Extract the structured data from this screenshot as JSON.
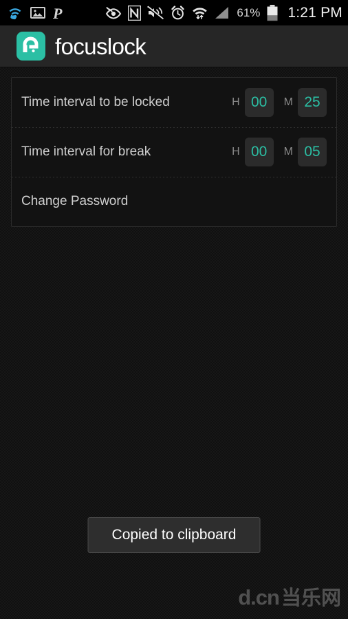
{
  "status_bar": {
    "left_icons": [
      {
        "name": "wifi-calling-icon",
        "glyph": "wifi-call"
      },
      {
        "name": "gallery-image-icon",
        "glyph": "image"
      },
      {
        "name": "paypal-icon",
        "glyph": "P"
      }
    ],
    "right_icons": [
      {
        "name": "smart-stay-eye-icon",
        "glyph": "eye"
      },
      {
        "name": "nfc-icon",
        "glyph": "N"
      },
      {
        "name": "sound-muted-icon",
        "glyph": "mute"
      },
      {
        "name": "alarm-clock-icon",
        "glyph": "alarm"
      },
      {
        "name": "wifi-signal-icon",
        "glyph": "wifi"
      },
      {
        "name": "cellular-signal-icon",
        "glyph": "signal"
      }
    ],
    "battery_percent": "61%",
    "battery_level": 61,
    "clock": "1:21 PM"
  },
  "action_bar": {
    "app_title": "focuslock",
    "logo_name": "focuslock-padlock-logo",
    "accent_color": "#2bbfa4",
    "background_color": "#262626"
  },
  "settings": {
    "rows": [
      {
        "label": "Time interval to be locked",
        "type": "time",
        "hour_unit": "H",
        "hour_value": "00",
        "minute_unit": "M",
        "minute_value": "25"
      },
      {
        "label": "Time interval for break",
        "type": "time",
        "hour_unit": "H",
        "hour_value": "00",
        "minute_unit": "M",
        "minute_value": "05"
      },
      {
        "label": "Change Password",
        "type": "action"
      }
    ]
  },
  "toast": {
    "message": "Copied to clipboard"
  },
  "watermark": {
    "latin": "d.cn",
    "cjk": "当乐网"
  }
}
